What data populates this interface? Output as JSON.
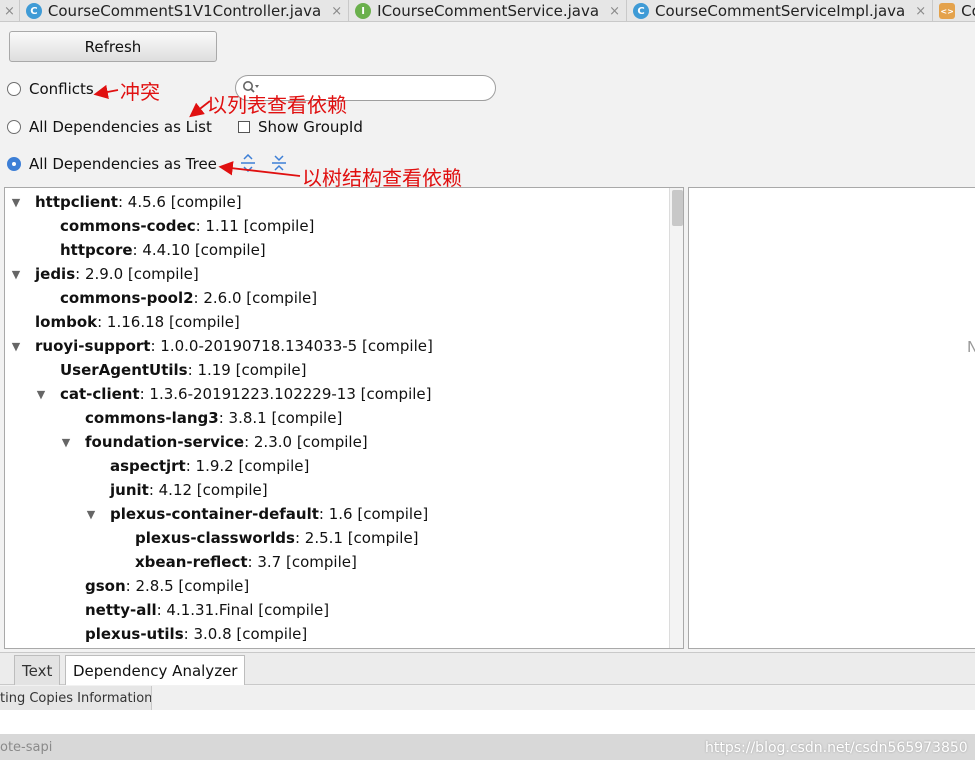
{
  "editor_tabs": [
    {
      "label": "CourseCommentS1V1Controller.java",
      "icon": "class-icon",
      "icon_glyph": "C"
    },
    {
      "label": "ICourseCommentService.java",
      "icon": "interface-icon",
      "icon_glyph": "I"
    },
    {
      "label": "CourseCommentServiceImpl.java",
      "icon": "class-icon",
      "icon_glyph": "C"
    },
    {
      "label": "Cou",
      "icon": "xml-icon",
      "icon_glyph": "<>"
    }
  ],
  "toolbar": {
    "refresh_label": "Refresh",
    "conflicts_label": "Conflicts",
    "list_label": "All Dependencies as List",
    "tree_label": "All Dependencies as Tree",
    "show_groupid_label": "Show GroupId",
    "search_value": "",
    "selected_mode": "tree"
  },
  "annotations": {
    "conflicts": "冲突",
    "list": "以列表查看依赖",
    "tree": "以树结构查看依赖",
    "color": "#e01010"
  },
  "tree": [
    {
      "name": "httpclient",
      "detail": " : 4.5.6 [compile]",
      "level": 0,
      "expanded": true
    },
    {
      "name": "commons-codec",
      "detail": " : 1.11 [compile]",
      "level": 1,
      "expanded": null
    },
    {
      "name": "httpcore",
      "detail": " : 4.4.10 [compile]",
      "level": 1,
      "expanded": null
    },
    {
      "name": "jedis",
      "detail": " : 2.9.0 [compile]",
      "level": 0,
      "expanded": true
    },
    {
      "name": "commons-pool2",
      "detail": " : 2.6.0 [compile]",
      "level": 1,
      "expanded": null
    },
    {
      "name": "lombok",
      "detail": " : 1.16.18 [compile]",
      "level": 0,
      "expanded": null
    },
    {
      "name": "ruoyi-support",
      "detail": " : 1.0.0-20190718.134033-5 [compile]",
      "level": 0,
      "expanded": true
    },
    {
      "name": "UserAgentUtils",
      "detail": " : 1.19 [compile]",
      "level": 1,
      "expanded": null
    },
    {
      "name": "cat-client",
      "detail": " : 1.3.6-20191223.102229-13 [compile]",
      "level": 1,
      "expanded": true
    },
    {
      "name": "commons-lang3",
      "detail": " : 3.8.1 [compile]",
      "level": 2,
      "expanded": null
    },
    {
      "name": "foundation-service",
      "detail": " : 2.3.0 [compile]",
      "level": 2,
      "expanded": true
    },
    {
      "name": "aspectjrt",
      "detail": " : 1.9.2 [compile]",
      "level": 3,
      "expanded": null
    },
    {
      "name": "junit",
      "detail": " : 4.12 [compile]",
      "level": 3,
      "expanded": null
    },
    {
      "name": "plexus-container-default",
      "detail": " : 1.6 [compile]",
      "level": 3,
      "expanded": true
    },
    {
      "name": "plexus-classworlds",
      "detail": " : 2.5.1 [compile]",
      "level": 4,
      "expanded": null
    },
    {
      "name": "xbean-reflect",
      "detail": " : 3.7 [compile]",
      "level": 4,
      "expanded": null
    },
    {
      "name": "gson",
      "detail": " : 2.8.5 [compile]",
      "level": 2,
      "expanded": null
    },
    {
      "name": "netty-all",
      "detail": " : 4.1.31.Final [compile]",
      "level": 2,
      "expanded": null
    },
    {
      "name": "plexus-utils",
      "detail": " : 3.0.8 [compile]",
      "level": 2,
      "expanded": null
    }
  ],
  "right_pane": {
    "visible_char": "N"
  },
  "bottom_tabs": {
    "text_label": "Text",
    "analyzer_label": "Dependency Analyzer",
    "active": "analyzer"
  },
  "info_tab": {
    "label": "ting Copies Information"
  },
  "status": {
    "left": "ote-sapi"
  },
  "watermark": "https://blog.csdn.net/csdn565973850"
}
